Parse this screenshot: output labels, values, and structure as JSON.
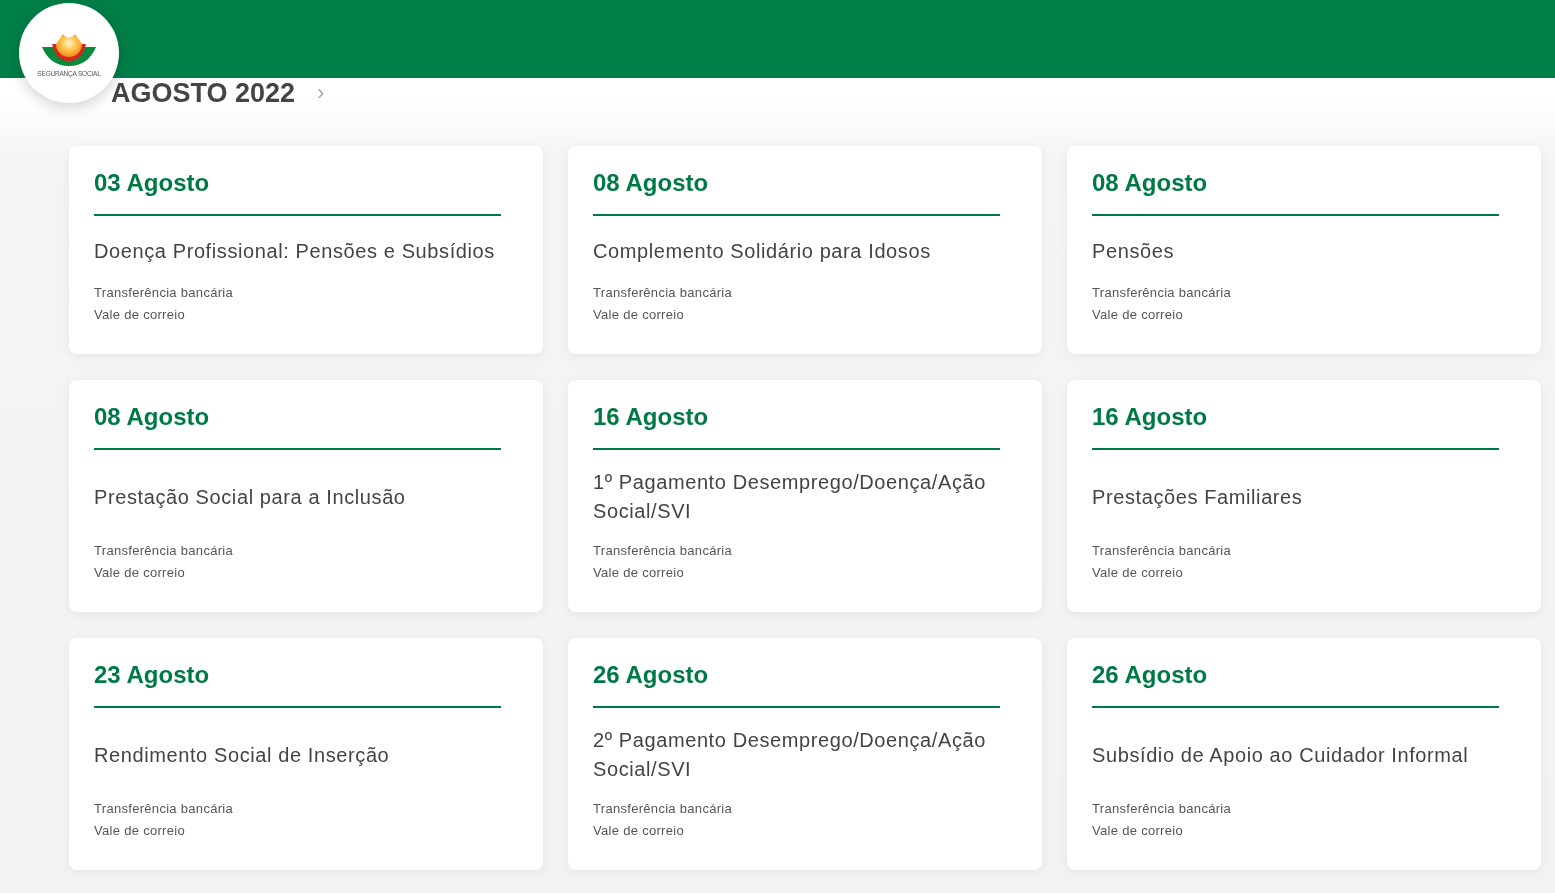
{
  "logo": {
    "text": "SEGURANÇA SOCIAL"
  },
  "month": {
    "title": "AGOSTO 2022",
    "next": "›"
  },
  "payments": [
    {
      "date": "03 Agosto",
      "title": "Doença Profissional: Pensões e Subsídios",
      "methods": [
        "Transferência bancária",
        "Vale de correio"
      ]
    },
    {
      "date": "08 Agosto",
      "title": "Complemento Solidário para Idosos",
      "methods": [
        "Transferência bancária",
        "Vale de correio"
      ]
    },
    {
      "date": "08 Agosto",
      "title": "Pensões",
      "methods": [
        "Transferência bancária",
        "Vale de correio"
      ]
    },
    {
      "date": "08 Agosto",
      "title": "Prestação Social para a Inclusão",
      "methods": [
        "Transferência bancária",
        "Vale de correio"
      ]
    },
    {
      "date": "16 Agosto",
      "title": "1º Pagamento Desemprego/Doença/Ação Social/SVI",
      "methods": [
        "Transferência bancária",
        "Vale de correio"
      ]
    },
    {
      "date": "16 Agosto",
      "title": "Prestações Familiares",
      "methods": [
        "Transferência bancária",
        "Vale de correio"
      ]
    },
    {
      "date": "23 Agosto",
      "title": "Rendimento Social de Inserção",
      "methods": [
        "Transferência bancária",
        "Vale de correio"
      ]
    },
    {
      "date": "26 Agosto",
      "title": "2º Pagamento Desemprego/Doença/Ação Social/SVI",
      "methods": [
        "Transferência bancária",
        "Vale de correio"
      ]
    },
    {
      "date": "26 Agosto",
      "title": "Subsídio de Apoio ao Cuidador Informal",
      "methods": [
        "Transferência bancária",
        "Vale de correio"
      ]
    }
  ]
}
